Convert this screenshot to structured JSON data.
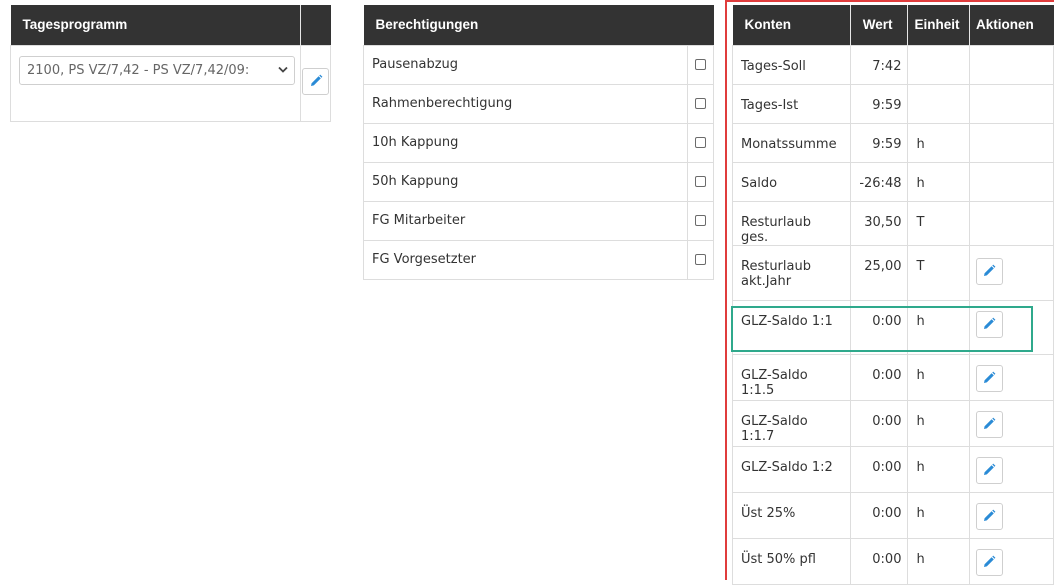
{
  "tagesprogramm": {
    "header": "Tagesprogramm",
    "selected": "2100, PS VZ/7,42 - PS VZ/7,42/09:"
  },
  "berechtigungen": {
    "header": "Berechtigungen",
    "items": [
      {
        "label": "Pausenabzug",
        "checked": false
      },
      {
        "label": "Rahmenberechtigung",
        "checked": false
      },
      {
        "label": "10h Kappung",
        "checked": false
      },
      {
        "label": "50h Kappung",
        "checked": false
      },
      {
        "label": "FG Mitarbeiter",
        "checked": false
      },
      {
        "label": "FG Vorgesetzter",
        "checked": false
      }
    ]
  },
  "konten": {
    "headers": {
      "konten": "Konten",
      "wert": "Wert",
      "einheit": "Einheit",
      "aktionen": "Aktionen"
    },
    "rows": [
      {
        "konto": "Tages-Soll",
        "wert": "7:42",
        "einheit": "",
        "edit": false
      },
      {
        "konto": "Tages-Ist",
        "wert": "9:59",
        "einheit": "",
        "edit": false
      },
      {
        "konto": "Monatssumme",
        "wert": "9:59",
        "einheit": "h",
        "edit": false
      },
      {
        "konto": "Saldo",
        "wert": "-26:48",
        "einheit": "h",
        "edit": false
      },
      {
        "konto": "Resturlaub ges.",
        "wert": "30,50",
        "einheit": "T",
        "edit": false
      },
      {
        "konto": "Resturlaub akt.Jahr",
        "wert": "25,00",
        "einheit": "T",
        "edit": true
      },
      {
        "konto": "GLZ-Saldo 1:1",
        "wert": "0:00",
        "einheit": "h",
        "edit": true
      },
      {
        "konto": "GLZ-Saldo 1:1.5",
        "wert": "0:00",
        "einheit": "h",
        "edit": true
      },
      {
        "konto": "GLZ-Saldo 1:1.7",
        "wert": "0:00",
        "einheit": "h",
        "edit": true
      },
      {
        "konto": "GLZ-Saldo 1:2",
        "wert": "0:00",
        "einheit": "h",
        "edit": true
      },
      {
        "konto": "Üst 25%",
        "wert": "0:00",
        "einheit": "h",
        "edit": true
      },
      {
        "konto": "Üst 50% pfl",
        "wert": "0:00",
        "einheit": "h",
        "edit": true
      }
    ]
  },
  "colors": {
    "header_bg": "#333333",
    "highlight_red": "#e03c3c",
    "highlight_green": "#2fa98c",
    "pencil": "#2a8bd6"
  }
}
